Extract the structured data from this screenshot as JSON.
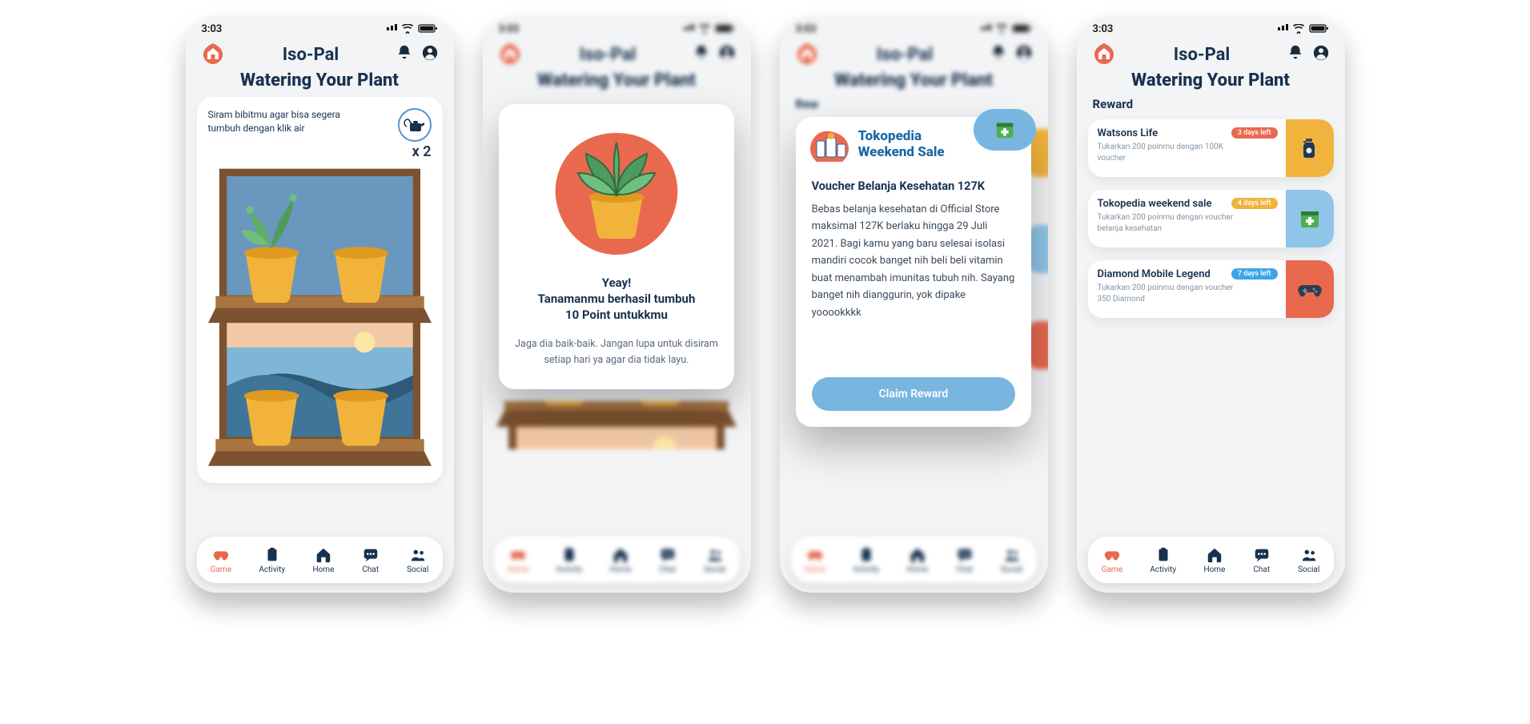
{
  "status_bar": {
    "time": "3:03"
  },
  "header": {
    "app_title": "Iso-Pal"
  },
  "page_title": "Watering Your Plant",
  "nav": {
    "items": [
      {
        "id": "game",
        "label": "Game"
      },
      {
        "id": "activity",
        "label": "Activity"
      },
      {
        "id": "home",
        "label": "Home"
      },
      {
        "id": "chat",
        "label": "Chat"
      },
      {
        "id": "social",
        "label": "Social"
      }
    ]
  },
  "screen1": {
    "instruction": "Siram bibitmu agar bisa segera tumbuh dengan klik air",
    "water_count": "x 2"
  },
  "screen2": {
    "line1": "Yeay!",
    "line2": "Tanamanmu berhasil tumbuh",
    "line3": "10 Point untukkmu",
    "body": "Jaga dia baik-baik. Jangan lupa untuk disiram setiap hari ya agar dia tidak layu."
  },
  "screen3": {
    "banner_title_1": "Tokopedia",
    "banner_title_2": "Weekend Sale",
    "subtitle": "Voucher Belanja Kesehatan 127K",
    "body": "Bebas belanja kesehatan di Official Store maksimal 127K berlaku hingga 29 Juli 2021. Bagi kamu yang baru selesai isolasi mandiri cocok banget nih beli beli vitamin buat menambah imunitas tubuh nih. Sayang banget nih dianggurin, yok dipake yooookkkk",
    "button": "Claim Reward",
    "peek_label": "Rew"
  },
  "screen4": {
    "section_title": "Reward",
    "rewards": [
      {
        "name": "Watsons Life",
        "desc": "Tukarkan 200 poinmu dengan 100K voucher",
        "days_left": "3 days left",
        "badge_color": "#e9694f",
        "accent_color": "#f2b33d",
        "icon": "sanitizer"
      },
      {
        "name": "Tokopedia weekend sale",
        "desc": "Tukarkan 200 poinmu dengan voucher belanja kesehatan",
        "days_left": "4 days left",
        "badge_color": "#f2b33d",
        "accent_color": "#8fc5e8",
        "icon": "medkit"
      },
      {
        "name": "Diamond Mobile Legend",
        "desc": "Tukarkan 200 poinmu dengan voucher 350 Diamond",
        "days_left": "7 days left",
        "badge_color": "#3da5e8",
        "accent_color": "#e9694f",
        "icon": "gamepad"
      }
    ]
  },
  "colors": {
    "brand_orange": "#e9694f",
    "brand_navy": "#17324f",
    "blue_soft": "#78b6e0",
    "yellow": "#f2b33d"
  }
}
